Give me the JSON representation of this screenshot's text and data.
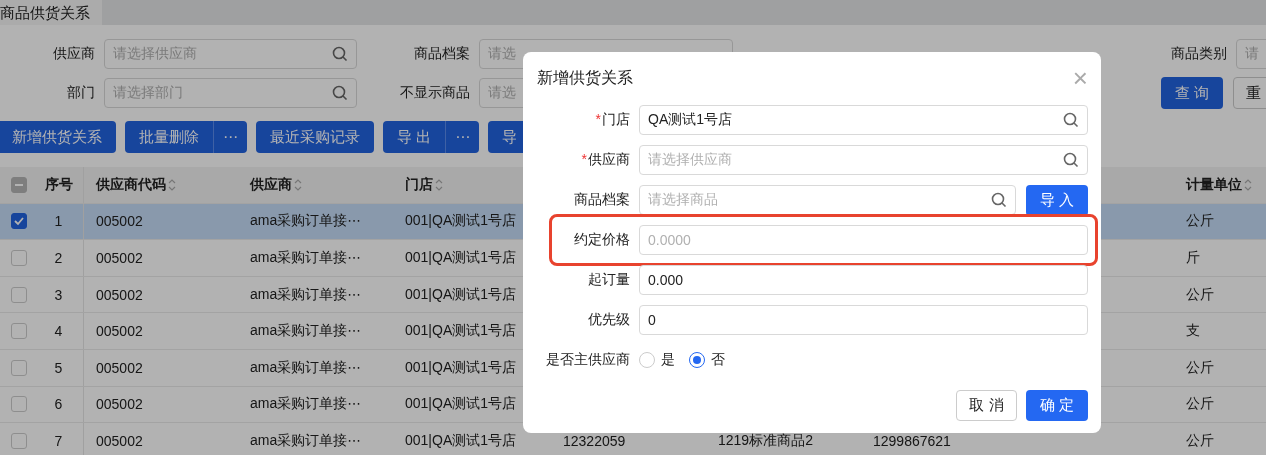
{
  "tab": {
    "label": "商品供货关系",
    "selected": true
  },
  "filter_rows": [
    {
      "fields": [
        {
          "label": "供应商",
          "placeholder": "请选择供应商",
          "kind": "search"
        },
        {
          "label": "商品档案",
          "placeholder": "请选",
          "kind": "text"
        }
      ],
      "right_label": "商品类别",
      "right_placeholder": "请"
    },
    {
      "fields": [
        {
          "label": "部门",
          "placeholder": "请选择部门",
          "kind": "search"
        },
        {
          "label": "不显示商品",
          "placeholder": "请选",
          "kind": "text"
        }
      ],
      "buttons": [
        {
          "label": "查 询",
          "kind": "primary"
        },
        {
          "label": "重",
          "kind": "default"
        }
      ]
    }
  ],
  "toolbar": [
    {
      "label": "新增供货关系"
    },
    {
      "label": "批量删除",
      "more": "⋯"
    },
    {
      "label": "最近采购记录"
    },
    {
      "label": "导 出",
      "more": "⋯"
    },
    {
      "label": "导"
    }
  ],
  "table": {
    "header_checkbox": {
      "indeterminate": true
    },
    "columns": [
      {
        "label": "序号",
        "sortable": false
      },
      {
        "label": "供应商代码",
        "sortable": true
      },
      {
        "label": "供应商",
        "sortable": true
      },
      {
        "label": "门店",
        "sortable": true
      },
      {
        "label": "计量单位",
        "sortable": true
      }
    ],
    "rows": [
      {
        "checked": true,
        "no": "1",
        "code": "005002",
        "supplier": "ama采购订单接⋯",
        "store": "001|QA测试1号店",
        "unit": "公斤"
      },
      {
        "checked": false,
        "no": "2",
        "code": "005002",
        "supplier": "ama采购订单接⋯",
        "store": "001|QA测试1号店",
        "unit": "斤"
      },
      {
        "checked": false,
        "no": "3",
        "code": "005002",
        "supplier": "ama采购订单接⋯",
        "store": "001|QA测试1号店",
        "unit": "公斤"
      },
      {
        "checked": false,
        "no": "4",
        "code": "005002",
        "supplier": "ama采购订单接⋯",
        "store": "001|QA测试1号店",
        "unit": "支"
      },
      {
        "checked": false,
        "no": "5",
        "code": "005002",
        "supplier": "ama采购订单接⋯",
        "store": "001|QA测试1号店",
        "unit": "公斤"
      },
      {
        "checked": false,
        "no": "6",
        "code": "005002",
        "supplier": "ama采购订单接⋯",
        "store": "001|QA测试1号店",
        "unit": "公斤"
      },
      {
        "checked": false,
        "no": "7",
        "code": "005002",
        "supplier": "ama采购订单接⋯",
        "store": "001|QA测试1号店",
        "column_6": "12322059",
        "column_7": "1219标准商品2",
        "column_8": "1299867621",
        "unit": "公斤"
      }
    ]
  },
  "dialog": {
    "title": "新增供货关系",
    "close": "×",
    "fields": [
      {
        "label": "门店",
        "mark": "*",
        "kind": "search",
        "value": "QA测试1号店",
        "highlighted": false
      },
      {
        "label": "供应商",
        "mark": "*",
        "kind": "search",
        "placeholder": "请选择供应商",
        "highlighted": false
      },
      {
        "label": "商品档案",
        "kind": "search_button",
        "placeholder": "请选择商品",
        "button": "导 入",
        "highlighted": false
      },
      {
        "label": "约定价格",
        "kind": "text",
        "placeholder": "0.0000",
        "highlighted": true
      },
      {
        "label": "起订量",
        "kind": "text",
        "value": "0.000",
        "highlighted": false
      },
      {
        "label": "优先级",
        "kind": "text",
        "value": "0",
        "highlighted": false
      },
      {
        "label": "是否主供应商",
        "kind": "radio",
        "highlighted": false,
        "options": [
          {
            "label": "是",
            "selected": false
          },
          {
            "label": "否",
            "selected": true
          }
        ]
      }
    ],
    "buttons": [
      {
        "label": "取 消",
        "kind": "default"
      },
      {
        "label": "确 定",
        "kind": "primary"
      }
    ]
  }
}
